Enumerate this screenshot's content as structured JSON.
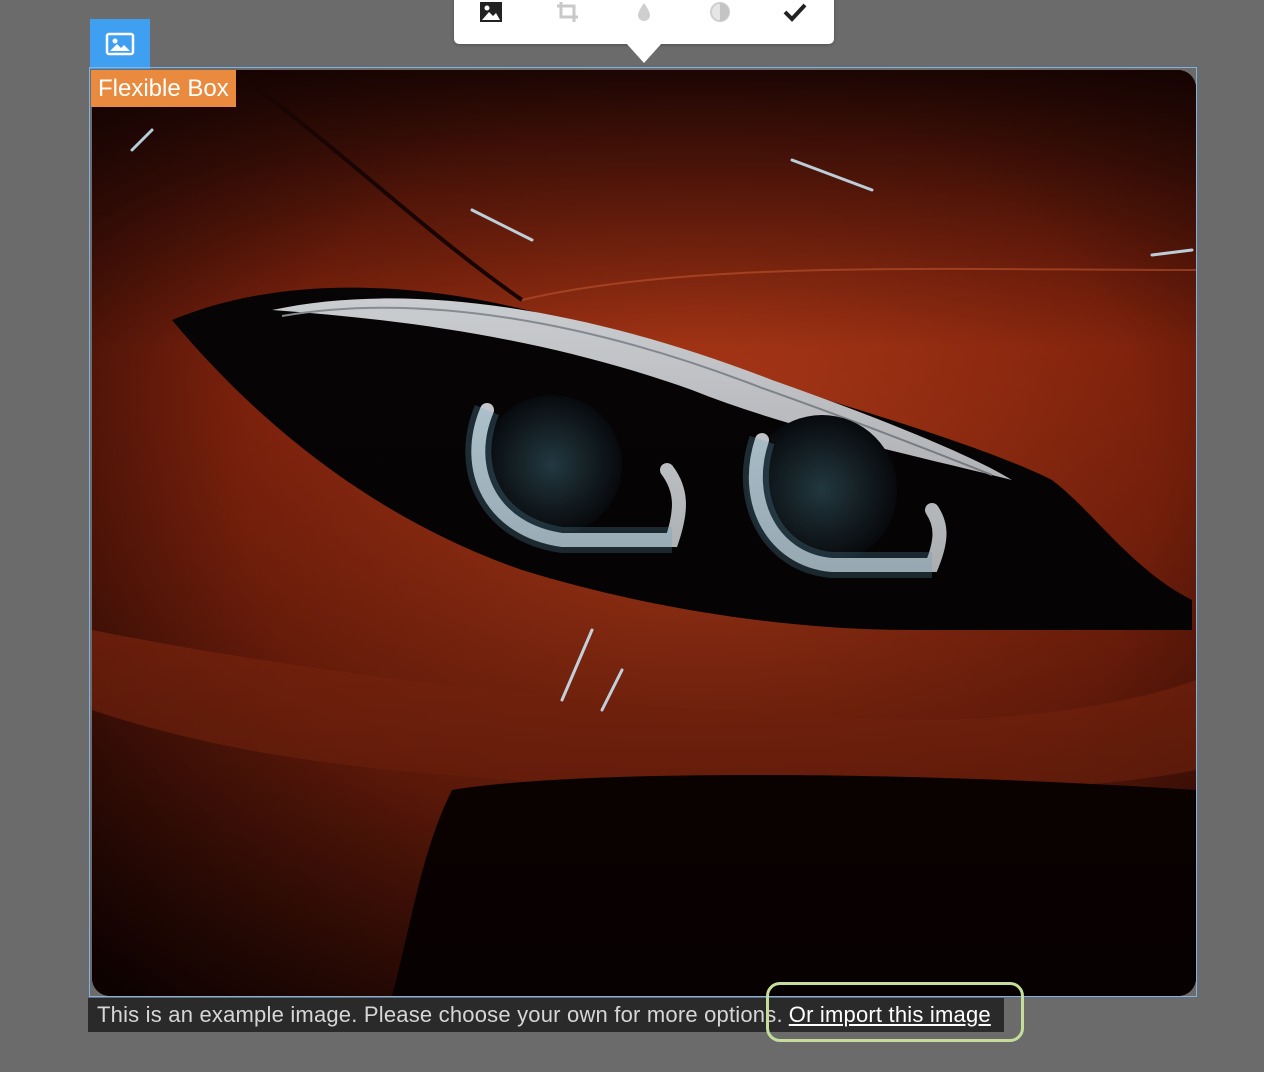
{
  "toolbar": {
    "buttons": [
      {
        "name": "image-icon",
        "label": ""
      },
      {
        "name": "crop-icon",
        "label": ""
      },
      {
        "name": "blur-icon",
        "label": ""
      },
      {
        "name": "contrast-icon",
        "label": ""
      },
      {
        "name": "check-icon",
        "label": ""
      }
    ]
  },
  "badge": {
    "icon": "image-icon",
    "color": "#3f9ff0"
  },
  "block_label": "Flexible Box",
  "image": {
    "subject": "car-headlight",
    "palette": {
      "body": "#c8401a",
      "dark": "#140404",
      "light": "#eaf6ff"
    }
  },
  "caption": {
    "text": "This is an example image. Please choose your own for more options.",
    "link": "Or import this image"
  },
  "colors": {
    "background": "#6b6b6b",
    "label_bg": "#e98a3f",
    "highlight": "#c4dd9a",
    "frame": "#7fb3e6"
  }
}
